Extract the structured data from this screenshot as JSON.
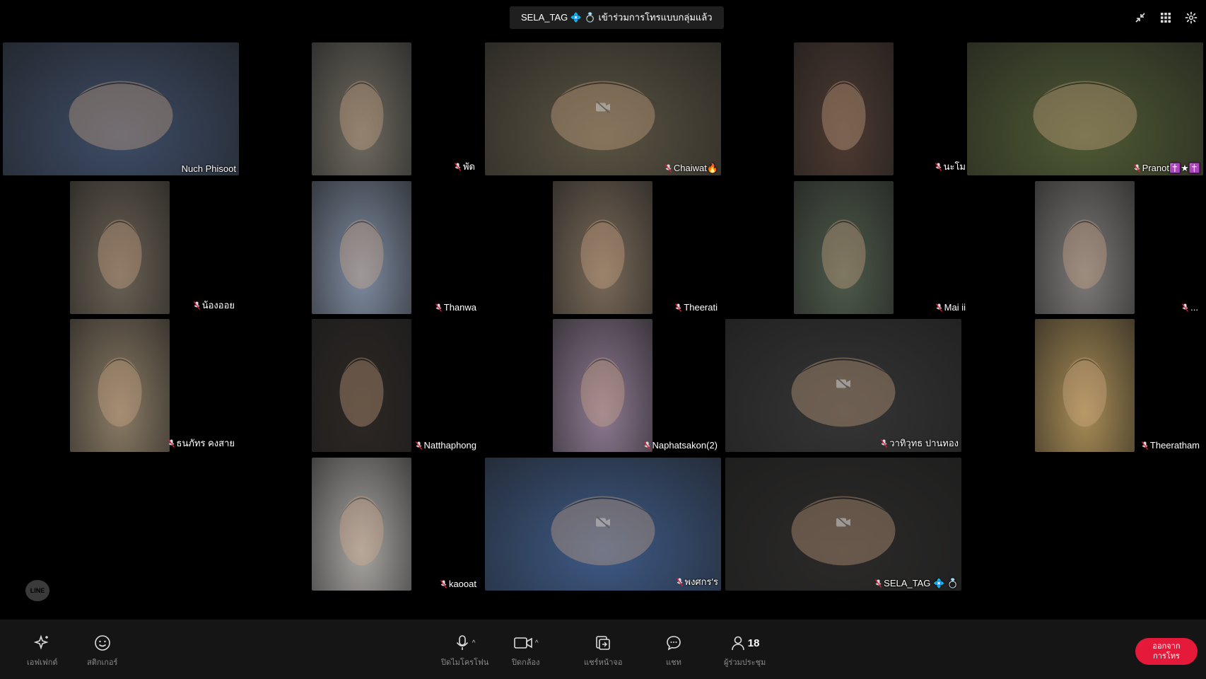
{
  "toast": {
    "text": "SELA_TAG 💠 💍 เข้าร่วมการโทรแบบกลุ่มแล้ว"
  },
  "top_icons": [
    "minimize-icon",
    "grid-view-icon",
    "settings-icon"
  ],
  "participants": [
    {
      "name": "Nuch   Phisoot",
      "mic_off": false,
      "cam_off": false,
      "color": "#3d4c66"
    },
    {
      "name": "พัด",
      "mic_off": true,
      "cam_off": false,
      "color": "#6e6a60"
    },
    {
      "name": "Chaiwat🔥",
      "mic_off": true,
      "cam_off": true,
      "color": "#5b5443"
    },
    {
      "name": "นะโม",
      "mic_off": true,
      "cam_off": false,
      "color": "#4d3a31"
    },
    {
      "name": "Pranot✝️★✝️",
      "mic_off": true,
      "cam_off": false,
      "color": "#4f5a34"
    },
    {
      "name": "น้องออย",
      "mic_off": true,
      "cam_off": false,
      "color": "#6a6154"
    },
    {
      "name": "Thanwa",
      "mic_off": true,
      "cam_off": false,
      "color": "#7e8ba0"
    },
    {
      "name": "Theerati",
      "mic_off": true,
      "cam_off": false,
      "color": "#7a6a59"
    },
    {
      "name": "Mai ii",
      "mic_off": true,
      "cam_off": false,
      "color": "#4e5a4b"
    },
    {
      "name": "...",
      "mic_off": true,
      "cam_off": false,
      "color": "#7d7a78"
    },
    {
      "name": "ธนภัทร คงสาย",
      "mic_off": true,
      "cam_off": false,
      "color": "#8a7b65"
    },
    {
      "name": "Natthaphong",
      "mic_off": true,
      "cam_off": false,
      "color": "#2c2724"
    },
    {
      "name": "Naphatsakon(2)",
      "mic_off": true,
      "cam_off": false,
      "color": "#8e7a92"
    },
    {
      "name": "วาทิวุทธ ปานทอง",
      "mic_off": true,
      "cam_off": true,
      "color": "#353535"
    },
    {
      "name": "Theeratham",
      "mic_off": true,
      "cam_off": false,
      "color": "#a88c55"
    },
    {
      "name": "kaooat",
      "mic_off": true,
      "cam_off": false,
      "color": "#a8a5a2"
    },
    {
      "name": "พงศกร'ร",
      "mic_off": true,
      "cam_off": true,
      "color": "#3e5a86"
    },
    {
      "name": "SELA_TAG 💠 💍",
      "mic_off": true,
      "cam_off": true,
      "color": "#2b2a29"
    }
  ],
  "line_logo": "LINE",
  "bottom": {
    "effects": "เอฟเฟกต์",
    "stickers": "สติกเกอร์",
    "mic": "ปิดไมโครโฟน",
    "camera": "ปิดกล้อง",
    "share": "แชร์หน้าจอ",
    "chat": "แชท",
    "participants_label": "ผู้ร่วมประชุม",
    "participants_count": "18",
    "leave": "ออกจาก\nการโทร"
  },
  "colors": {
    "leave": "#e5193a",
    "bar": "#151515",
    "background": "#000000"
  }
}
